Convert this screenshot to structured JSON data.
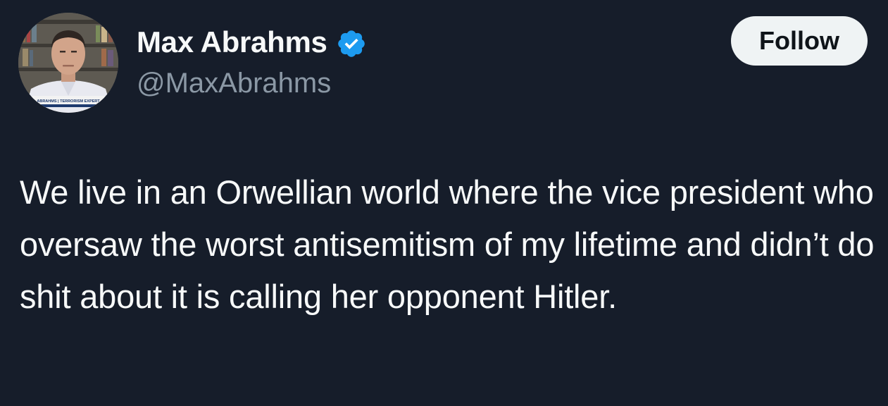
{
  "tweet": {
    "author": {
      "display_name": "Max Abrahms",
      "handle": "@MaxAbrahms",
      "verified": true,
      "avatar_caption": "ABRAHMS | TERRORISM EXPERT"
    },
    "follow_label": "Follow",
    "text": "We live in an Orwellian world where the vice president who oversaw the worst antisemitism of my lifetime and didn’t do shit about it is calling her opponent Hitler."
  },
  "colors": {
    "background": "#161d2a",
    "text_primary": "#f7f9f9",
    "text_secondary": "#8b98a5",
    "verified_blue": "#1d9bf0",
    "button_bg": "#eff3f4",
    "button_text": "#0f1419"
  },
  "icons": {
    "verified": "verified-badge-icon"
  }
}
